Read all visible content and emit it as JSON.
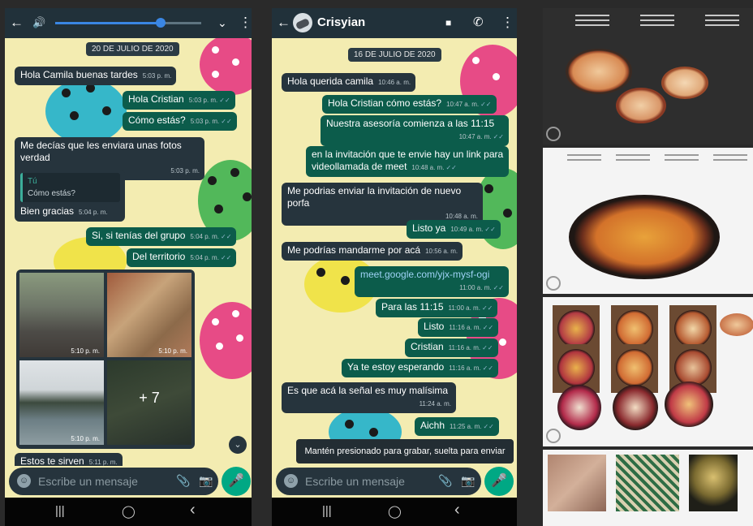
{
  "phone1": {
    "date": "20 DE JULIO DE 2020",
    "messages": [
      {
        "dir": "in",
        "text": "Hola Camila buenas tardes",
        "time": "5:03 p. m."
      },
      {
        "dir": "out",
        "text": "Hola  Cristian",
        "time": "5:03 p. m."
      },
      {
        "dir": "out",
        "text": "Cómo estás?",
        "time": "5:03 p. m."
      },
      {
        "dir": "in",
        "text": "Me decías que les enviara unas fotos verdad",
        "time": "5:03 p. m."
      },
      {
        "dir": "in",
        "quote_author": "Tú",
        "quote_text": "Cómo estás?",
        "text": "Bien gracias",
        "time": "5:04 p. m."
      },
      {
        "dir": "out",
        "text": "Si, si tenías del grupo",
        "time": "5:04 p. m."
      },
      {
        "dir": "out",
        "text": "Del territorio",
        "time": "5:04 p. m."
      }
    ],
    "album": {
      "times": [
        "5:10 p. m.",
        "5:10 p. m.",
        "5:10 p. m."
      ],
      "more": "+ 7"
    },
    "last_message": {
      "text": "Estos te sirven",
      "time": "5:11 p. m."
    },
    "input_placeholder": "Escribe un mensaje"
  },
  "phone2": {
    "contact": "Crisyian",
    "date": "16 DE JULIO DE 2020",
    "messages": [
      {
        "dir": "in",
        "text": "Hola querida camila",
        "time": "10:46 a. m."
      },
      {
        "dir": "out",
        "text": "Hola Cristian cómo estás?",
        "time": "10:47 a. m."
      },
      {
        "dir": "out",
        "text": "Nuestra asesoría comienza a las 11:15",
        "time": "10:47 a. m."
      },
      {
        "dir": "out",
        "text": "en la invitación que te envie hay un link para videollamada de meet",
        "time": "10:48 a. m."
      },
      {
        "dir": "in",
        "text": "Me podrias enviar la invitación de nuevo porfa",
        "time": "10:48 a. m."
      },
      {
        "dir": "out",
        "text": "Listo ya",
        "time": "10:49 a. m."
      },
      {
        "dir": "in",
        "text": "Me podrías mandarme por acá",
        "time": "10:56 a. m."
      },
      {
        "dir": "out",
        "text": "meet.google.com/yjx-mysf-ogi",
        "time": "11:00 a. m."
      },
      {
        "dir": "out",
        "text": "Para las 11:15",
        "time": "11:00 a. m."
      },
      {
        "dir": "out",
        "text": "Listo",
        "time": "11:16 a. m."
      },
      {
        "dir": "out",
        "text": "Cristian",
        "time": "11:16 a. m."
      },
      {
        "dir": "out",
        "text": "Ya te estoy esperando",
        "time": "11:16 a. m."
      },
      {
        "dir": "in",
        "text": "Es que acá la señal es muy malísima",
        "time": "11:24 a. m."
      },
      {
        "dir": "out",
        "text": "Aichh",
        "time": "11:25 a. m."
      }
    ],
    "tooltip": "Mantén presionado para grabar, suelta para enviar",
    "input_placeholder": "Escribe un mensaje"
  },
  "volume_level": 0.72,
  "ticks": "✓✓",
  "icons": {
    "back": "←",
    "volume": "🔊",
    "chevron": "⌄",
    "menu": "⋮",
    "video": "■",
    "call": "✆",
    "mic": "🎤",
    "clip": "📎",
    "camera": "📷",
    "emoji": "☺",
    "recents": "|||",
    "home": "◯",
    "nav_back": "‹",
    "scroll_down": "⌄"
  },
  "colors": {
    "header": "#21313a",
    "incoming": "#26343d",
    "outgoing": "#0c5c4b",
    "accent": "#00a884",
    "wallpaper": "#f3ecb1"
  }
}
